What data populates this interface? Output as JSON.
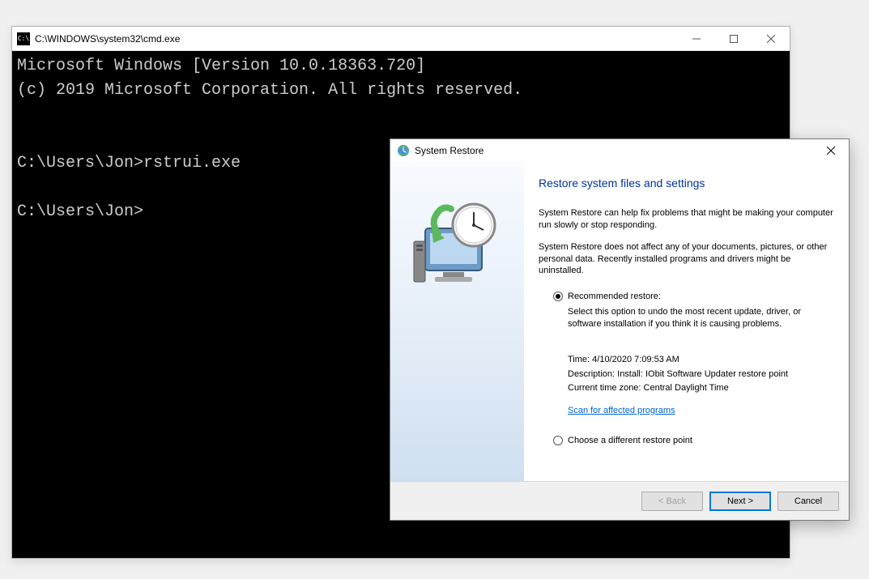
{
  "cmd": {
    "title": "C:\\WINDOWS\\system32\\cmd.exe",
    "icon_label": "C:\\",
    "lines": {
      "banner1": "Microsoft Windows [Version 10.0.18363.720]",
      "banner2": "(c) 2019 Microsoft Corporation. All rights reserved.",
      "blank1": "",
      "blank2": "",
      "prompt1": "C:\\Users\\Jon>rstrui.exe",
      "blank3": "",
      "prompt2": "C:\\Users\\Jon>"
    }
  },
  "restore": {
    "window_title": "System Restore",
    "heading": "Restore system files and settings",
    "para1": "System Restore can help fix problems that might be making your computer run slowly or stop responding.",
    "para2": "System Restore does not affect any of your documents, pictures, or other personal data. Recently installed programs and drivers might be uninstalled.",
    "option_recommended": "Recommended restore:",
    "recommended_sub": "Select this option to undo the most recent update, driver, or software installation if you think it is causing problems.",
    "detail_time": "Time: 4/10/2020 7:09:53 AM",
    "detail_desc": "Description: Install: IObit Software Updater restore point",
    "detail_tz": "Current time zone: Central Daylight Time",
    "scan_link": "Scan for affected programs",
    "option_different": "Choose a different restore point",
    "btn_back": "< Back",
    "btn_next": "Next >",
    "btn_cancel": "Cancel"
  }
}
